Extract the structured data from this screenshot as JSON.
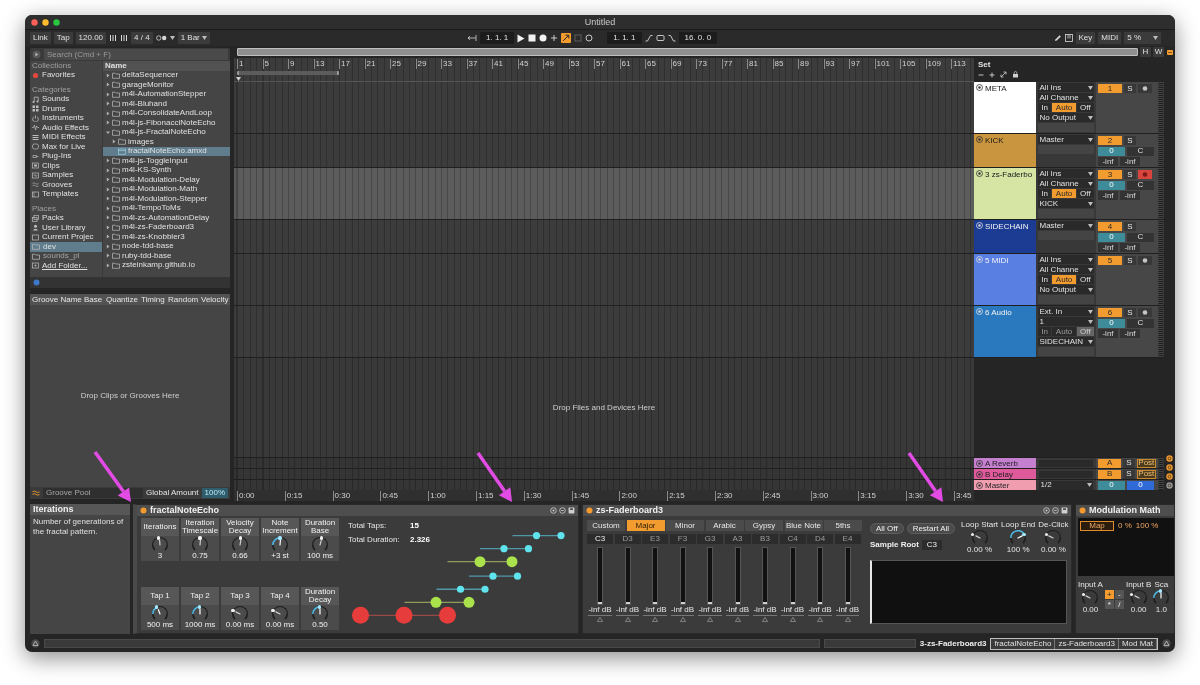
{
  "window": {
    "title": "Untitled"
  },
  "control_bar": {
    "link": "Link",
    "tap": "Tap",
    "tempo": "120.00",
    "signature": "4 / 4",
    "quantization": "1 Bar",
    "position": "1. 1. 1",
    "automation_arm": {
      "on": true
    },
    "loop_start": "1. 1. 1",
    "loop_length": "16. 0. 0",
    "key_map": "Key",
    "midi_map": "MIDI",
    "cpu_load": "5 %"
  },
  "browser": {
    "search": {
      "placeholder": "Search (Cmd + F)"
    },
    "sidebar": [
      {
        "heading": "Collections",
        "items": [
          {
            "label": "Favorites",
            "kind": "favorite",
            "selected": false
          }
        ]
      },
      {
        "heading": "Categories",
        "items": [
          {
            "label": "Sounds",
            "kind": "note",
            "selected": false
          },
          {
            "label": "Drums",
            "kind": "grid",
            "selected": false
          },
          {
            "label": "Instruments",
            "kind": "power",
            "selected": false
          },
          {
            "label": "Audio Effects",
            "kind": "wave",
            "selected": false
          },
          {
            "label": "MIDI Effects",
            "kind": "midi",
            "selected": false
          },
          {
            "label": "Max for Live",
            "kind": "max",
            "selected": false
          },
          {
            "label": "Plug-Ins",
            "kind": "plug",
            "selected": false
          },
          {
            "label": "Clips",
            "kind": "clip",
            "selected": false
          },
          {
            "label": "Samples",
            "kind": "sample",
            "selected": false
          },
          {
            "label": "Grooves",
            "kind": "groove",
            "selected": false
          },
          {
            "label": "Templates",
            "kind": "template",
            "selected": false
          }
        ]
      },
      {
        "heading": "Places",
        "items": [
          {
            "label": "Packs",
            "kind": "pack",
            "selected": false,
            "disabled": false
          },
          {
            "label": "User Library",
            "kind": "user",
            "selected": false,
            "disabled": false
          },
          {
            "label": "Current Projec",
            "kind": "project",
            "selected": false,
            "disabled": false
          },
          {
            "label": "dev",
            "kind": "folder",
            "selected": true,
            "disabled": false
          },
          {
            "label": "sounds_pl",
            "kind": "folder",
            "selected": false,
            "disabled": true
          },
          {
            "label": "Add Folder...",
            "kind": "add",
            "selected": false,
            "disabled": false
          }
        ]
      }
    ],
    "files": {
      "header": "Name",
      "items": [
        {
          "label": "deltaSequencer",
          "kind": "folder",
          "expanded": false,
          "selected": false
        },
        {
          "label": "garageMonitor",
          "kind": "folder",
          "expanded": false,
          "selected": false
        },
        {
          "label": "m4l-AutomationStepper",
          "kind": "folder",
          "expanded": false,
          "selected": false
        },
        {
          "label": "m4l-Bluhand",
          "kind": "folder",
          "expanded": false,
          "selected": false
        },
        {
          "label": "m4l-ConsolidateAndLoop",
          "kind": "folder",
          "expanded": false,
          "selected": false
        },
        {
          "label": "m4l-js-FibonacciNoteEcho",
          "kind": "folder",
          "expanded": false,
          "selected": false
        },
        {
          "label": "m4l-js-FractalNoteEcho",
          "kind": "folder",
          "expanded": true,
          "selected": false,
          "children": [
            {
              "label": "images",
              "kind": "folder",
              "expanded": false,
              "selected": false
            },
            {
              "label": "fractalNoteEcho.amxd",
              "kind": "file",
              "selected": true
            }
          ]
        },
        {
          "label": "m4l-js-ToggleInput",
          "kind": "folder",
          "expanded": false,
          "selected": false
        },
        {
          "label": "m4l-KS-Synth",
          "kind": "folder",
          "expanded": false,
          "selected": false
        },
        {
          "label": "m4l-Modulation-Delay",
          "kind": "folder",
          "expanded": false,
          "selected": false
        },
        {
          "label": "m4l-Modulation-Math",
          "kind": "folder",
          "expanded": false,
          "selected": false
        },
        {
          "label": "m4l-Modulation-Stepper",
          "kind": "folder",
          "expanded": false,
          "selected": false
        },
        {
          "label": "m4l-TempoToMs",
          "kind": "folder",
          "expanded": false,
          "selected": false
        },
        {
          "label": "m4l-zs-AutomationDelay",
          "kind": "folder",
          "expanded": false,
          "selected": false
        },
        {
          "label": "m4l-zs-Faderboard3",
          "kind": "folder",
          "expanded": false,
          "selected": false
        },
        {
          "label": "m4l-zs-Knobbler3",
          "kind": "folder",
          "expanded": false,
          "selected": false
        },
        {
          "label": "node-tdd-base",
          "kind": "folder",
          "expanded": false,
          "selected": false
        },
        {
          "label": "ruby-tdd-base",
          "kind": "folder",
          "expanded": false,
          "selected": false
        },
        {
          "label": "zsteinkamp.github.io",
          "kind": "folder",
          "expanded": false,
          "selected": false
        }
      ]
    }
  },
  "groove_pool": {
    "columns": [
      "Groove Name",
      "Base",
      "Quantize",
      "Timing",
      "Random",
      "Velocity"
    ],
    "empty_text": "Drop Clips or Grooves Here",
    "footer_label": "Groove Pool",
    "global_amount_label": "Global Amount",
    "global_amount": "100%"
  },
  "arrangement": {
    "overview_buttons": [
      "H",
      "W"
    ],
    "bar_numbers": [
      "1",
      "5",
      "9",
      "13",
      "17",
      "21",
      "25",
      "29",
      "33",
      "37",
      "41",
      "45",
      "49",
      "53",
      "57",
      "61",
      "65",
      "69",
      "73",
      "77",
      "81",
      "85",
      "89",
      "93",
      "97",
      "101",
      "105",
      "109",
      "113"
    ],
    "set_label": "Set",
    "drop_text": "Drop Files and Devices Here",
    "time_labels": [
      "0:00",
      "0:15",
      "0:30",
      "0:45",
      "1:00",
      "1:15",
      "1:30",
      "1:45",
      "2:00",
      "2:15",
      "2:30",
      "2:45",
      "3:00",
      "3:15",
      "3:30",
      "3:45"
    ]
  },
  "tracks": [
    {
      "name": "META",
      "color": "#ffffff",
      "number": "1",
      "selected": false,
      "input": "All Ins",
      "channel": "All Channe",
      "monitor": {
        "disabled": false,
        "options": [
          {
            "label": "In",
            "selected": false
          },
          {
            "label": "Auto",
            "selected": true
          },
          {
            "label": "Off",
            "selected": false
          }
        ]
      },
      "output": "No Output",
      "solo": "S",
      "armed": false
    },
    {
      "name": "KICK",
      "color": "#c9963f",
      "number": "2",
      "selected": false,
      "output": "Master",
      "solo": "S",
      "volume": "0",
      "pan": "C",
      "meters": [
        "-inf",
        "-inf"
      ]
    },
    {
      "name": "3 zs-Faderbo",
      "color": "#d6e4a4",
      "number": "3",
      "selected": true,
      "input": "All Ins",
      "channel": "All Channe",
      "monitor": {
        "disabled": false,
        "options": [
          {
            "label": "In",
            "selected": false
          },
          {
            "label": "Auto",
            "selected": true
          },
          {
            "label": "Off",
            "selected": false
          }
        ]
      },
      "output": "KICK",
      "solo": "S",
      "armed": true,
      "volume": "0",
      "pan": "C",
      "meters": [
        "-inf",
        "-inf"
      ]
    },
    {
      "name": "SIDECHAIN",
      "color": "#1c3c93",
      "number": "4",
      "selected": false,
      "output": "Master",
      "solo": "S",
      "volume": "0",
      "pan": "C",
      "meters": [
        "-inf",
        "-inf"
      ]
    },
    {
      "name": "5 MIDI",
      "color": "#5a7fe2",
      "number": "5",
      "selected": false,
      "input": "All Ins",
      "channel": "All Channe",
      "monitor": {
        "disabled": false,
        "options": [
          {
            "label": "In",
            "selected": false
          },
          {
            "label": "Auto",
            "selected": true
          },
          {
            "label": "Off",
            "selected": false
          }
        ]
      },
      "output": "No Output",
      "solo": "S",
      "armed": false
    },
    {
      "name": "6 Audio",
      "color": "#2a78bd",
      "number": "6",
      "selected": false,
      "input": "Ext. In",
      "channel": "1",
      "monitor": {
        "disabled": true,
        "options": [
          {
            "label": "In",
            "selected": false
          },
          {
            "label": "Auto",
            "selected": false
          },
          {
            "label": "Off",
            "selected": true
          }
        ]
      },
      "output": "SIDECHAIN",
      "solo": "S",
      "armed": false,
      "volume": "0",
      "pan": "C",
      "meters": [
        "-inf",
        "-inf"
      ]
    }
  ],
  "returns": [
    {
      "kind": "return",
      "name": "A Reverb",
      "color": "#c47fcf",
      "letter": "A",
      "solo": "S",
      "send_mode": "Post"
    },
    {
      "kind": "return",
      "name": "B Delay",
      "color": "#de5a9a",
      "letter": "B",
      "solo": "S",
      "send_mode": "Post"
    },
    {
      "kind": "master",
      "name": "Master",
      "color": "#f19db0",
      "output": "1/2",
      "volume": "0",
      "pan": "0"
    }
  ],
  "info": {
    "title": "Iterations",
    "text": "Number of generations of the fractal pattern."
  },
  "fractal_note_echo": {
    "title": "fractalNoteEcho",
    "on": true,
    "knobs": [
      {
        "label": "Iterations",
        "value": "3",
        "level": 0.45,
        "accent": false
      },
      {
        "label": "Iteration Timescale",
        "value": "0.75",
        "level": 0.55,
        "accent": false
      },
      {
        "label": "Velocity Decay",
        "value": "0.66",
        "level": 0.6,
        "accent": false
      },
      {
        "label": "Note Increment",
        "value": "+3 st",
        "level": 0.55,
        "accent": true
      },
      {
        "label": "Duration Base",
        "value": "100 ms",
        "level": 0.65,
        "accent": false
      },
      {
        "label": "Tap 1",
        "value": "500 ms",
        "level": 0.3,
        "accent": true
      },
      {
        "label": "Tap 2",
        "value": "1000 ms",
        "level": 0.5,
        "accent": true
      },
      {
        "label": "Tap 3",
        "value": "0.00 ms",
        "level": 0,
        "accent": false
      },
      {
        "label": "Tap 4",
        "value": "0.00 ms",
        "level": 0,
        "accent": false
      },
      {
        "label": "Duration Decay",
        "value": "0.50",
        "level": 0.5,
        "accent": true
      }
    ],
    "stats": [
      {
        "label": "Total Taps:",
        "value": "15"
      },
      {
        "label": "Total Duration:",
        "value": "2.326"
      }
    ]
  },
  "faderboard": {
    "title": "zs-Faderboard3",
    "on": true,
    "scales": [
      {
        "label": "Custom",
        "selected": false
      },
      {
        "label": "Major",
        "selected": true
      },
      {
        "label": "Minor",
        "selected": false
      },
      {
        "label": "Arabic",
        "selected": false
      },
      {
        "label": "Gypsy",
        "selected": false
      },
      {
        "label": "Blue Note",
        "selected": false
      },
      {
        "label": "5ths",
        "selected": false
      }
    ],
    "notes": [
      {
        "label": "C3",
        "selected": true
      },
      {
        "label": "D3",
        "selected": false
      },
      {
        "label": "E3",
        "selected": false
      },
      {
        "label": "F3",
        "selected": false
      },
      {
        "label": "G3",
        "selected": false
      },
      {
        "label": "A3",
        "selected": false
      },
      {
        "label": "B3",
        "selected": false
      },
      {
        "label": "C4",
        "selected": false
      },
      {
        "label": "D4",
        "selected": false
      },
      {
        "label": "E4",
        "selected": false
      }
    ],
    "faders": [
      {
        "value": "-inf dB",
        "level": 0
      },
      {
        "value": "-inf dB",
        "level": 0
      },
      {
        "value": "-inf dB",
        "level": 0
      },
      {
        "value": "-inf dB",
        "level": 0
      },
      {
        "value": "-inf dB",
        "level": 0
      },
      {
        "value": "-inf dB",
        "level": 0
      },
      {
        "value": "-inf dB",
        "level": 0
      },
      {
        "value": "-inf dB",
        "level": 0
      },
      {
        "value": "-inf dB",
        "level": 0
      },
      {
        "value": "-inf dB",
        "level": 0
      }
    ],
    "buttons": [
      "All Off",
      "Restart All"
    ],
    "sample_root_label": "Sample Root",
    "sample_root": "C3",
    "knobs": [
      {
        "label": "Loop Start",
        "value": "0.00 %",
        "level": 0,
        "accent": false
      },
      {
        "label": "Loop End",
        "value": "100 %",
        "level": 1,
        "accent": true
      },
      {
        "label": "De-Click",
        "value": "0.00 %",
        "level": 0,
        "accent": false
      }
    ]
  },
  "modulation_math": {
    "title": "Modulation Math",
    "on": true,
    "map": "Map",
    "range_min": "0 %",
    "range_max": "100 %",
    "inputs": [
      {
        "label": "Input A",
        "value": "0.00",
        "level": 0,
        "accent": false
      },
      {
        "label": "Input B",
        "value": "0.00",
        "level": 0,
        "accent": false
      },
      {
        "label": "Sca",
        "value": "1.0",
        "level": 0.5,
        "accent": true
      }
    ],
    "operators": [
      {
        "label": "+",
        "selected": true
      },
      {
        "label": "-",
        "selected": false
      },
      {
        "label": "*",
        "selected": false
      },
      {
        "label": "/",
        "selected": false
      }
    ]
  },
  "status_bar": {
    "track": "3-zs-Faderboard3",
    "devices": [
      "fractalNoteEcho",
      "zs-Faderboard3",
      "Mod Mat"
    ]
  }
}
